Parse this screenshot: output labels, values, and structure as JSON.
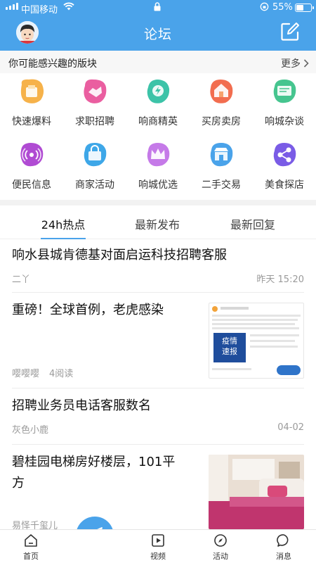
{
  "status_bar": {
    "carrier": "中国移动",
    "battery_pct": "55%",
    "battery_level": 0.55
  },
  "header": {
    "title": "论坛",
    "avatar_icon": "avatar-icon",
    "compose_icon": "compose-icon"
  },
  "boards": {
    "section_title": "你可能感兴趣的版块",
    "more_label": "更多",
    "items": [
      {
        "label": "快速爆料",
        "icon": "inbox-icon",
        "color": "#f6b24a"
      },
      {
        "label": "求职招聘",
        "icon": "handshake-icon",
        "color": "#ea5ea0"
      },
      {
        "label": "响商精英",
        "icon": "bolt-icon",
        "color": "#3cc3a8"
      },
      {
        "label": "买房卖房",
        "icon": "house-icon",
        "color": "#f26d4f"
      },
      {
        "label": "响城杂谈",
        "icon": "chat-icon",
        "color": "#46c58f"
      },
      {
        "label": "便民信息",
        "icon": "broadcast-icon",
        "color": "#b04bd3"
      },
      {
        "label": "商家活动",
        "icon": "bag-icon",
        "color": "#3ea7e8"
      },
      {
        "label": "响城优选",
        "icon": "crown-icon",
        "color": "#c57ae8"
      },
      {
        "label": "二手交易",
        "icon": "shop-icon",
        "color": "#4aa3ea"
      },
      {
        "label": "美食探店",
        "icon": "share-icon",
        "color": "#7a5ce6"
      }
    ]
  },
  "tabs": [
    {
      "label": "24h热点",
      "active": true
    },
    {
      "label": "最新发布",
      "active": false
    },
    {
      "label": "最新回复",
      "active": false
    }
  ],
  "posts": [
    {
      "title": "响水县城肯德基对面启运科技招聘客服",
      "author": "二丫",
      "time": "昨天 15:20"
    },
    {
      "title": "重磅！全球首例，老虎感染",
      "author": "嘤嘤嘤",
      "reads": "4阅读",
      "thumb_text_1": "疫情",
      "thumb_text_2": "速报"
    },
    {
      "title": "招聘业务员电话客服数名",
      "author": "灰色小鹿",
      "time": "04-02"
    },
    {
      "title_line1": "碧桂园电梯房好楼层，101平",
      "title_line2": "方",
      "author": "易怿千玺儿"
    }
  ],
  "bottom_nav": {
    "home": "首页",
    "publish": "发布",
    "video": "视频",
    "activity": "活动",
    "messages": "消息"
  },
  "colors": {
    "brand": "#4aa3ea",
    "muted": "#9a9a9a"
  }
}
